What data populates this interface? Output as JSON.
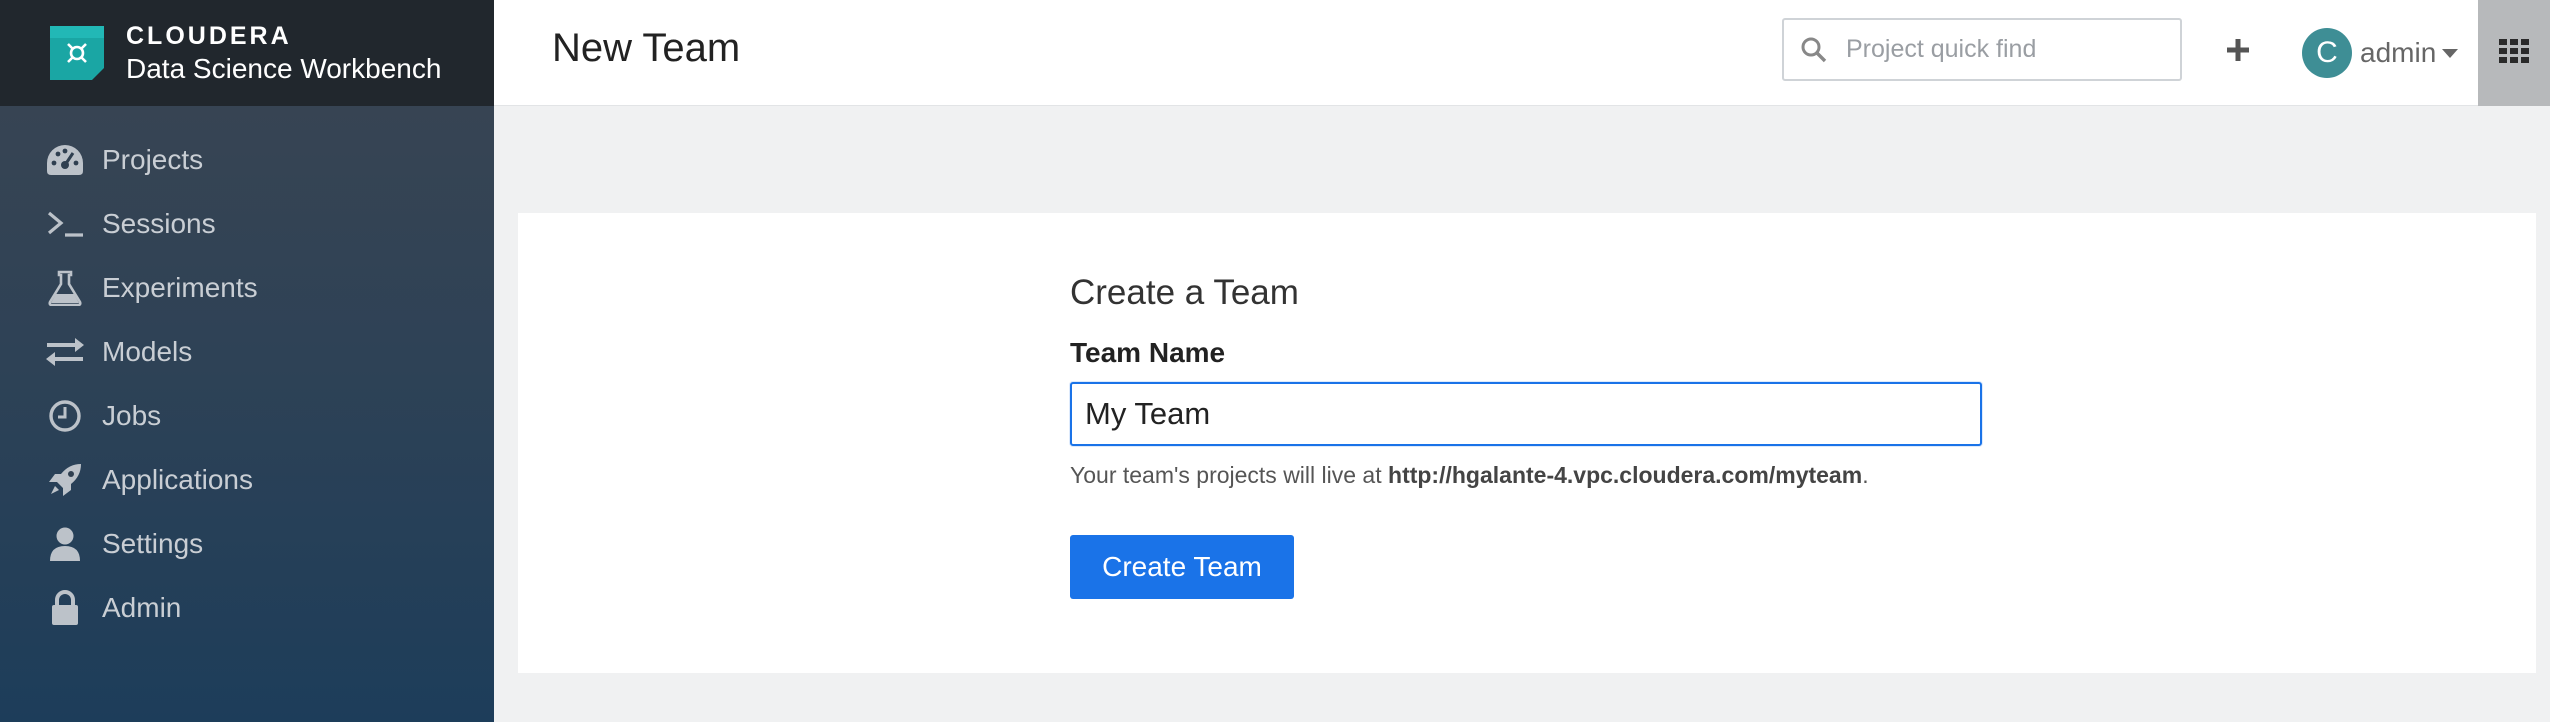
{
  "app": {
    "company": "CLOUDERA",
    "product": "Data Science Workbench",
    "brand_color": "#1aa6a4"
  },
  "sidebar": {
    "items": [
      {
        "label": "Projects",
        "icon": "dashboard-icon"
      },
      {
        "label": "Sessions",
        "icon": "terminal-icon"
      },
      {
        "label": "Experiments",
        "icon": "flask-icon"
      },
      {
        "label": "Models",
        "icon": "exchange-arrows-icon"
      },
      {
        "label": "Jobs",
        "icon": "clock-icon"
      },
      {
        "label": "Applications",
        "icon": "rocket-icon"
      },
      {
        "label": "Settings",
        "icon": "user-icon"
      },
      {
        "label": "Admin",
        "icon": "lock-icon"
      }
    ]
  },
  "header": {
    "title": "New Team",
    "search_placeholder": "Project quick find",
    "avatar_initial": "C",
    "username": "admin"
  },
  "form": {
    "title": "Create a Team",
    "team_name_label": "Team Name",
    "team_name_value": "My Team",
    "help_prefix": "Your team's projects will live at ",
    "help_url": "http://hgalante-4.vpc.cloudera.com/myteam",
    "help_suffix": ".",
    "submit_label": "Create Team"
  },
  "colors": {
    "primary": "#1a73e8",
    "avatar": "#3e8e95",
    "sidebar_top": "#21272d"
  }
}
